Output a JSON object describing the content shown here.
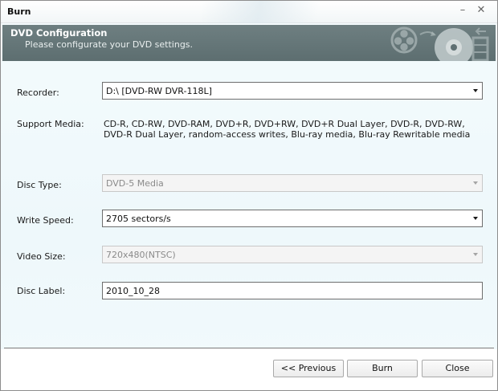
{
  "window": {
    "title": "Burn",
    "minimize_glyph": "–",
    "close_glyph": "✕"
  },
  "header": {
    "title": "DVD Configuration",
    "subtitle": "Please configurate your DVD settings."
  },
  "form": {
    "recorder": {
      "label": "Recorder:",
      "value": "D:\\ [DVD-RW  DVR-118L]"
    },
    "support_media": {
      "label": "Support Media:",
      "value": "CD-R, CD-RW, DVD-RAM, DVD+R, DVD+RW, DVD+R Dual Layer, DVD-R, DVD-RW, DVD-R Dual Layer, random-access writes, Blu-ray media, Blu-ray Rewritable media"
    },
    "disc_type": {
      "label": "Disc Type:",
      "value": "DVD-5 Media",
      "enabled": false
    },
    "write_speed": {
      "label": "Write Speed:",
      "value": "2705 sectors/s",
      "enabled": true
    },
    "video_size": {
      "label": "Video Size:",
      "value": "720x480(NTSC)",
      "enabled": false
    },
    "disc_label": {
      "label": "Disc Label:",
      "value": "2010_10_28"
    }
  },
  "buttons": {
    "previous": "<< Previous",
    "burn": "Burn",
    "close": "Close"
  },
  "icons": {
    "film_reel": "film-reel-icon",
    "disc": "disc-icon",
    "film_strip": "film-strip-icon"
  }
}
